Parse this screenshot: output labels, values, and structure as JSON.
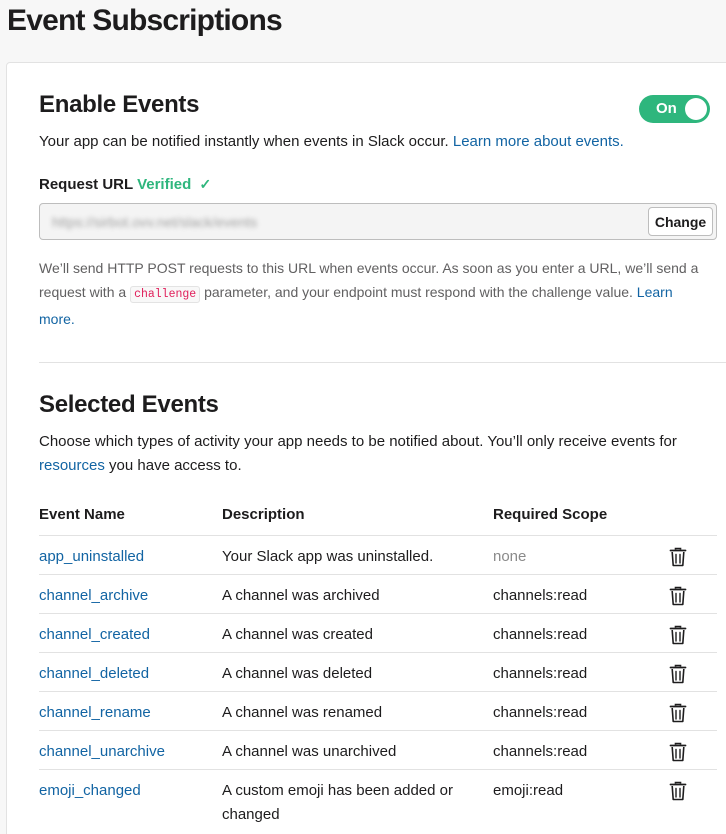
{
  "page_title": "Event Subscriptions",
  "enable_events": {
    "title": "Enable Events",
    "toggle_label": "On",
    "toggle_on": true,
    "description": "Your app can be notified instantly when events in Slack occur.",
    "learn_more_link": "Learn more about events."
  },
  "request_url": {
    "label": "Request URL",
    "status": "Verified",
    "status_icon": "check-icon",
    "value": "https://sirbot.ovv.net/slack/events",
    "change_label": "Change",
    "help_part1": "We’ll send HTTP POST requests to this URL when events occur. As soon as you enter a URL, we’ll send a request with a",
    "help_code": "challenge",
    "help_part2": "parameter, and your endpoint must respond with the challenge value.",
    "help_link": "Learn more."
  },
  "selected_events": {
    "title": "Selected Events",
    "description_part1": "Choose which types of activity your app needs to be notified about. You’ll only receive events for",
    "description_link": "resources",
    "description_part2": "you have access to.",
    "columns": [
      "Event Name",
      "Description",
      "Required Scope"
    ],
    "rows": [
      {
        "name": "app_uninstalled",
        "description": "Your Slack app was uninstalled.",
        "scope": "none"
      },
      {
        "name": "channel_archive",
        "description": "A channel was archived",
        "scope": "channels:read"
      },
      {
        "name": "channel_created",
        "description": "A channel was created",
        "scope": "channels:read"
      },
      {
        "name": "channel_deleted",
        "description": "A channel was deleted",
        "scope": "channels:read"
      },
      {
        "name": "channel_rename",
        "description": "A channel was renamed",
        "scope": "channels:read"
      },
      {
        "name": "channel_unarchive",
        "description": "A channel was unarchived",
        "scope": "channels:read"
      },
      {
        "name": "emoji_changed",
        "description": "A custom emoji has been added or changed",
        "scope": "emoji:read"
      }
    ]
  },
  "colors": {
    "accent_link": "#1264a3",
    "toggle_on": "#2eb67d",
    "verified": "#2eb67d",
    "code": "#e01e5a"
  }
}
